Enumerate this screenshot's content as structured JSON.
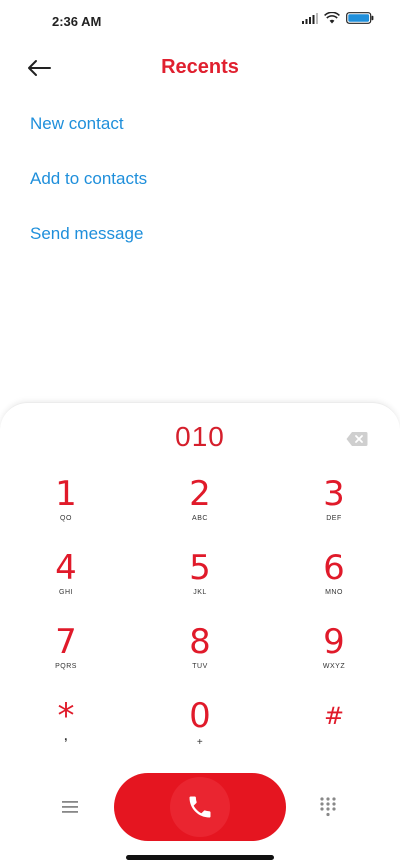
{
  "status_bar": {
    "time": "2:36 AM"
  },
  "header": {
    "title": "Recents"
  },
  "menu": {
    "items": [
      {
        "label": "New contact"
      },
      {
        "label": "Add to contacts"
      },
      {
        "label": "Send message"
      }
    ]
  },
  "dialer": {
    "number": "010",
    "keys": [
      {
        "digit": "1",
        "letters": "QO"
      },
      {
        "digit": "2",
        "letters": "ABC"
      },
      {
        "digit": "3",
        "letters": "DEF"
      },
      {
        "digit": "4",
        "letters": "GHI"
      },
      {
        "digit": "5",
        "letters": "JKL"
      },
      {
        "digit": "6",
        "letters": "MNO"
      },
      {
        "digit": "7",
        "letters": "PQRS"
      },
      {
        "digit": "8",
        "letters": "TUV"
      },
      {
        "digit": "9",
        "letters": "WXYZ"
      },
      {
        "digit": "*",
        "letters": ","
      },
      {
        "digit": "0",
        "letters": "+"
      },
      {
        "digit": "#",
        "letters": ""
      }
    ]
  },
  "colors": {
    "accent_red": "#e51520",
    "link_blue": "#1f8fdb"
  }
}
